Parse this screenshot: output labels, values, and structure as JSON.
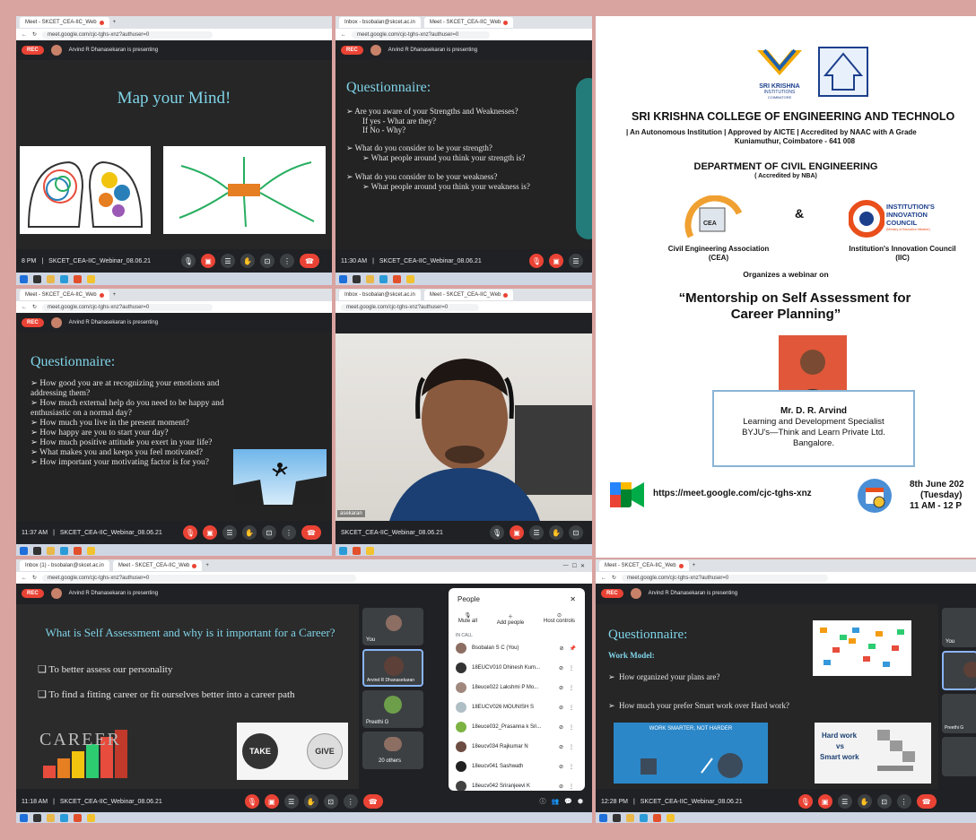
{
  "tabs": {
    "meet": "Meet - SKCET_CEA-IIC_Web",
    "inbox": "Inbox - bsobalan@skcet.ac.in",
    "inbox2": "Inbox (1) - bsobalan@skcet.ac.in",
    "new": "+"
  },
  "url": "meet.google.com/cjc-tghs-xnz?authuser=0",
  "presenting": "Arvind R Dhanasekaran is presenting",
  "rec": "REC",
  "meeting_name": "SKCET_CEA-IIC_Webinar_08.06.21",
  "times": {
    "t1": "8 PM",
    "t2": "11:30 AM",
    "t3": "11:37 AM",
    "t4": "11:18 AM",
    "t5": "12:28 PM"
  },
  "slide1": {
    "title": "Map your Mind!"
  },
  "slide2": {
    "title": "Questionnaire:",
    "q1": "Are you aware of your Strengths and Weaknesses?",
    "q1a": "If yes - What are they?",
    "q1b": "If No - Why?",
    "q2": "What do you consider to be your strength?",
    "q2a": "What people around you think your strength is?",
    "q3": "What do you consider to be your weakness?",
    "q3a": "What people around you think your weakness is?"
  },
  "slide3": {
    "title": "Questionnaire:",
    "items": [
      "How good you are at recognizing your emotions and addressing them?",
      "How much external help do you need to be happy and enthusiastic on a normal day?",
      "How much you live in the present moment?",
      "How happy are you to start your day?",
      "How much positive attitude you exert in your life?",
      "What makes you and keeps you feel motivated?",
      "How important your motivating factor is for you?"
    ]
  },
  "slide4": {
    "speaker_tag": "asekaran"
  },
  "slide5": {
    "title": "What is Self Assessment and why is it important for a Career?",
    "b1": "To better assess our personality",
    "b2": "To find a fitting career or fit ourselves better into a career path",
    "take": "TAKE",
    "give": "GIVE",
    "career": "CAREER"
  },
  "side_tiles": {
    "you": "You",
    "arvind": "Arvind R Dhanasekaran",
    "preethi": "Preethi G",
    "others": "20 others"
  },
  "people": {
    "title": "People",
    "mute_all": "Mute all",
    "add": "Add people",
    "host": "Host controls",
    "in_call": "IN CALL",
    "list": [
      "Bsobalan S C (You)",
      "18EUCV010 Dhinesh Kum...",
      "18euce022 Lakshmi P Mo...",
      "18EUCV026 MOUNISH S",
      "18euce032_Prasanna k Sri...",
      "18eucv034 Rajkumar N",
      "18eucv041 Sashwath",
      "18eucv042 Sriranjeevi K"
    ]
  },
  "slide6": {
    "title": "Questionnaire:",
    "sub": "Work Model:",
    "q1": "How organized your plans are?",
    "q2": "How much your prefer Smart work over Hard work?",
    "banner": "WORK SMARTER, NOT HARDER",
    "hw": "Hard work",
    "vs": "vs",
    "sw": "Smart work"
  },
  "poster": {
    "logo_text": "SRI KRISHNA",
    "logo_sub": "INSTITUTIONS",
    "logo_sub2": "COIMBATORE",
    "college": "SRI KRISHNA COLLEGE OF ENGINEERING AND TECHNOLO",
    "accr": "| An Autonomous Institution | Approved by AICTE | Accredited by NAAC with A Grade",
    "addr": "Kuniamuthur, Coimbatore - 641 008",
    "dept": "DEPARTMENT OF CIVIL ENGINEERING",
    "dept_sub": "( Accredited by NBA)",
    "cea_logo": "CEA",
    "iic_logo1": "INSTITUTION'S",
    "iic_logo2": "INNOVATION",
    "iic_logo3": "COUNCIL",
    "iic_logo4": "(Ministry of Education Initiative)",
    "amp": "&",
    "cea": "Civil Engineering Association",
    "cea_abbr": "(CEA)",
    "iic": "Institution's Innovation Council",
    "iic_abbr": "(IIC)",
    "organizes": "Organizes a webinar on",
    "topic1": "“Mentorship on Self Assessment for",
    "topic2": "Career Planning”",
    "speaker": "Mr. D. R. Arvind",
    "role": "Learning and Development Specialist",
    "company": "BYJU's—Think and Learn Private Ltd.",
    "city": "Bangalore.",
    "link": "https://meet.google.com/cjc-tghs-xnz",
    "date": "8th June 202",
    "day": "(Tuesday)",
    "time": "11 AM - 12 P"
  },
  "colors": {
    "frame": "#d9a3a0",
    "meet_dark": "#202124",
    "rec": "#ea4335",
    "slide_title": "#7fd3e8"
  }
}
